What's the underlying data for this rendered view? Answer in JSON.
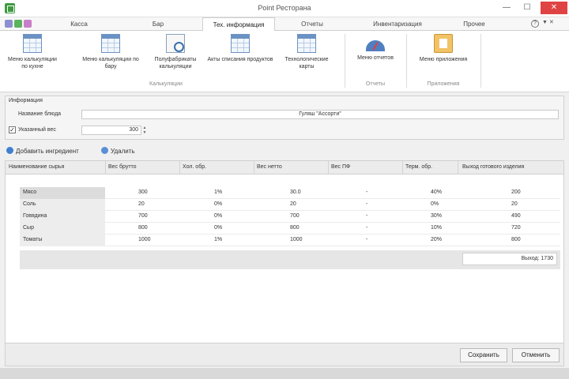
{
  "window": {
    "title": "Point Ресторана"
  },
  "tabs": [
    "Касса",
    "Бар",
    "Тех. информация",
    "Отчеты",
    "Инвентаризация",
    "Прочее"
  ],
  "active_tab": 2,
  "ribbon": {
    "buttons": [
      {
        "label": "Меню калькуляции по кухне",
        "icon": "table-icon"
      },
      {
        "label": "Меню калькуляции по бару",
        "icon": "table-icon"
      },
      {
        "label": "Полуфабрикаты калькуляции",
        "icon": "document-search-icon"
      },
      {
        "label": "Акты списания продуктов",
        "icon": "table-icon"
      },
      {
        "label": "Технологические карты",
        "icon": "table-icon"
      },
      {
        "label": "Меню отчетов",
        "icon": "gauge-icon"
      },
      {
        "label": "Меню приложения",
        "icon": "clipboard-icon"
      }
    ],
    "groups": [
      "Калькуляции",
      "Отчеты",
      "Приложения"
    ]
  },
  "info_panel": {
    "title": "Информация",
    "name_label": "Название блюда",
    "name_value": "Гуляш \"Ассорти\"",
    "checkbox_label": "Указанный вес",
    "checkbox_checked": true,
    "weight_value": "300"
  },
  "actions": {
    "add": "Добавить ингредиент",
    "delete": "Удалить"
  },
  "grid": {
    "columns": [
      "Наименование сырья",
      "Вес брутто",
      "Хол. обр.",
      "Вес нетто",
      "Вес ПФ",
      "Терм. обр.",
      "Выход готового изделия"
    ],
    "rows": [
      [
        "Мясо",
        "300",
        "1%",
        "30.0",
        "-",
        "40%",
        "200"
      ],
      [
        "Соль",
        "20",
        "0%",
        "20",
        "-",
        "0%",
        "20"
      ],
      [
        "Говядина",
        "700",
        "0%",
        "700",
        "-",
        "30%",
        "490"
      ],
      [
        "Сыр",
        "800",
        "0%",
        "800",
        "-",
        "10%",
        "720"
      ],
      [
        "Томаты",
        "1000",
        "1%",
        "1000",
        "-",
        "20%",
        "800"
      ]
    ],
    "summary": "Выход: 1730"
  },
  "footer": {
    "save": "Сохранить",
    "cancel": "Отменить"
  }
}
